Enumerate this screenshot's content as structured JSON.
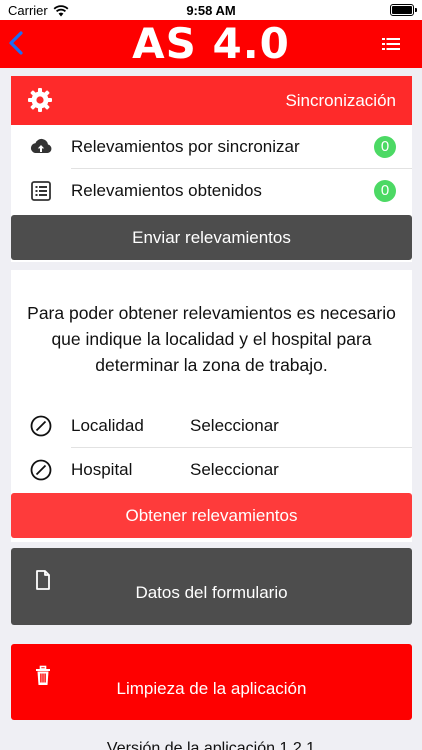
{
  "status_bar": {
    "carrier": "Carrier",
    "time": "9:58 AM"
  },
  "nav": {
    "title": "AS 4.0",
    "back_icon": "chevron-left-icon",
    "menu_icon": "list-icon"
  },
  "sync": {
    "title": "Sincronización",
    "rows": [
      {
        "label": "Relevamientos por sincronizar",
        "count": "0",
        "icon": "cloud-upload-icon"
      },
      {
        "label": "Relevamientos obtenidos",
        "count": "0",
        "icon": "list-icon"
      }
    ],
    "send_button": "Enviar relevamientos"
  },
  "info": {
    "message": "Para poder obtener relevamientos es necesario que indique la localidad y el hospital para determinar la zona de trabajo.",
    "fields": [
      {
        "label": "Localidad",
        "value": "Seleccionar"
      },
      {
        "label": "Hospital",
        "value": "Seleccionar"
      }
    ],
    "obtain_button": "Obtener relevamientos"
  },
  "form_button": "Datos del formulario",
  "clean_button": "Limpieza de la aplicación",
  "version": "Versión de la aplicación 1.2.1",
  "colors": {
    "accent": "#fe0000",
    "dark": "#4d4d4d",
    "badge": "#4cd964"
  }
}
